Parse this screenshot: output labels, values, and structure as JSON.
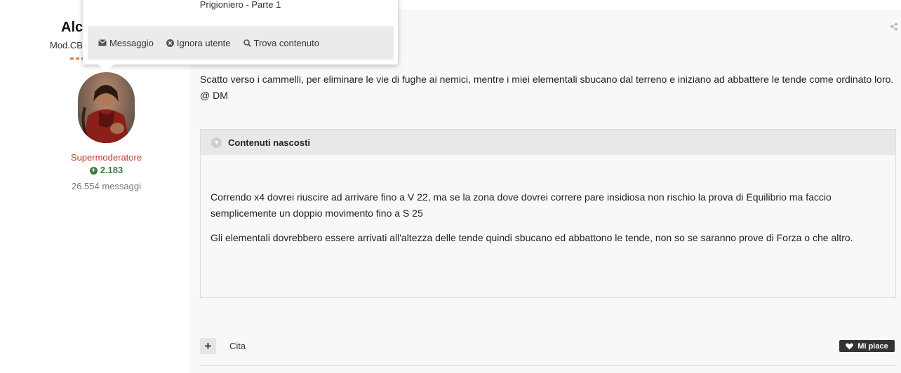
{
  "author": {
    "name": "Alc",
    "group": "Mod.CB",
    "role": "Supermoderatore",
    "reputation": "2.183",
    "posts_count": "26.554 messaggi"
  },
  "hovercard": {
    "title": "Prigioniero - Parte 1",
    "actions": {
      "message": "Messaggio",
      "ignore": "Ignora utente",
      "find": "Trova contenuto"
    }
  },
  "post": {
    "paragraph1": "Scatto verso i cammelli, per eliminare le vie di fughe ai nemici, mentre i miei elementali sbucano dal terreno e iniziano ad abbattere le tende come ordinato loro.",
    "paragraph2": "@ DM",
    "spoiler": {
      "header": "Contenuti nascosti",
      "p1": "Correndo x4 dovrei riuscire ad arrivare fino a V 22, ma se la zona dove dovrei correre pare insidiosa non rischio la prova di Equilibrio ma faccio semplicemente un doppio movimento fino a S 25",
      "p2": "Gli elementali dovrebbero essere arrivati all'altezza delle tende quindi sbucano ed abbattono le tende, non so se saranno prove di Forza o che altro."
    }
  },
  "footer": {
    "multiquote": "+",
    "quote_label": "Cita",
    "like_label": "Mi piace"
  },
  "colors": {
    "role": "#c0392b",
    "reputation": "#3e7b3e",
    "rank_bar": "#e07b39",
    "like_bg": "#333333"
  }
}
